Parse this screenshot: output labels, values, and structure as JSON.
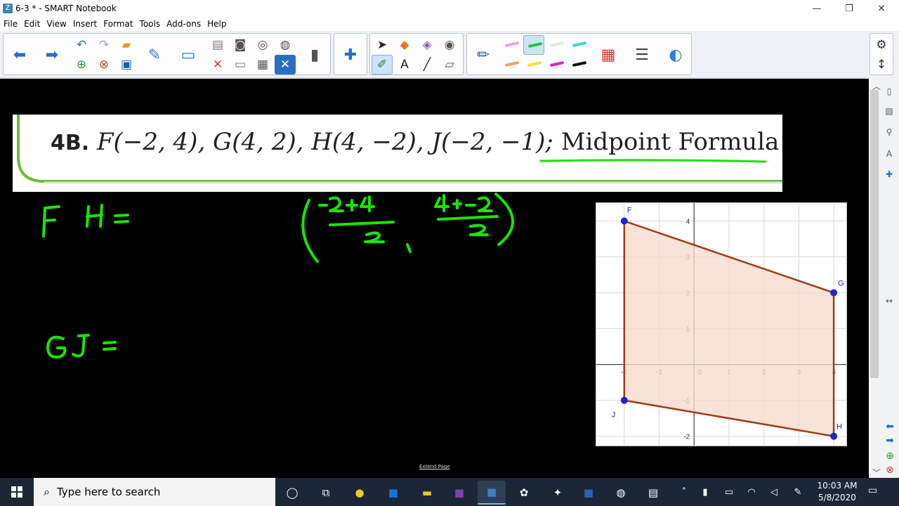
{
  "window": {
    "title": "6-3 * - SMART Notebook",
    "app_icon": "Z",
    "min": "—",
    "max": "❐",
    "close": "✕"
  },
  "menu": [
    "File",
    "Edit",
    "View",
    "Insert",
    "Format",
    "Tools",
    "Add-ons",
    "Help"
  ],
  "problem": {
    "label": "4B.",
    "points": "F(−2, 4), G(4, 2), H(4, −2), J(−2, −1);",
    "method": "Midpoint Formula"
  },
  "handwriting": {
    "line1": "FH =",
    "line2": "GJ =",
    "num1": "-2+4",
    "den1": "2",
    "num2": "4+-2",
    "den2": "2",
    "ink_color": "#17e600"
  },
  "graph": {
    "x_ticks": [
      "-2",
      "-1",
      "0",
      "1",
      "2",
      "3",
      "4"
    ],
    "y_ticks": [
      "4",
      "3",
      "2",
      "1",
      "-1",
      "-2"
    ],
    "points": [
      {
        "name": "F",
        "x": -2,
        "y": 4
      },
      {
        "name": "G",
        "x": 4,
        "y": 2
      },
      {
        "name": "H",
        "x": 4,
        "y": -2
      },
      {
        "name": "J",
        "x": -2,
        "y": -1
      }
    ],
    "x_range": [
      -2.8,
      4.4
    ],
    "y_range": [
      -2.3,
      4.5
    ],
    "fill_color": "#f7dccf",
    "edge_color": "#a33b10",
    "point_color": "#1a25d6"
  },
  "extend_page": "Extend Page",
  "taskbar": {
    "search_placeholder": "Type here to search",
    "time": "10:03 AM",
    "date": "5/8/2020"
  },
  "colors": {
    "canvas": "#000000",
    "toolbar_bg": "#eef1f5",
    "taskbar": "#1b2736"
  }
}
